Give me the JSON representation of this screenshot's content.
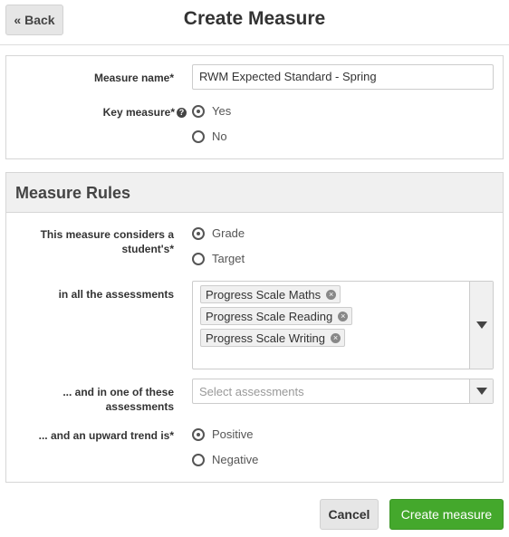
{
  "header": {
    "back_label": "« Back",
    "title": "Create Measure"
  },
  "form": {
    "measure_name_label": "Measure name",
    "measure_name_value": "RWM Expected Standard - Spring",
    "key_measure_label": "Key measure",
    "key_measure_options": [
      {
        "label": "Yes",
        "checked": true
      },
      {
        "label": "No",
        "checked": false
      }
    ]
  },
  "rules": {
    "title": "Measure Rules",
    "considers_label": "This measure considers a student's",
    "considers_options": [
      {
        "label": "Grade",
        "checked": true
      },
      {
        "label": "Target",
        "checked": false
      }
    ],
    "all_assessments_label": "in all the assessments",
    "all_assessments_tags": [
      "Progress Scale Maths",
      "Progress Scale Reading",
      "Progress Scale Writing"
    ],
    "one_of_label": "... and in one of these assessments",
    "one_of_placeholder": "Select assessments",
    "trend_label": "... and an upward trend is",
    "trend_options": [
      {
        "label": "Positive",
        "checked": true
      },
      {
        "label": "Negative",
        "checked": false
      }
    ]
  },
  "footer": {
    "cancel_label": "Cancel",
    "create_label": "Create measure"
  }
}
